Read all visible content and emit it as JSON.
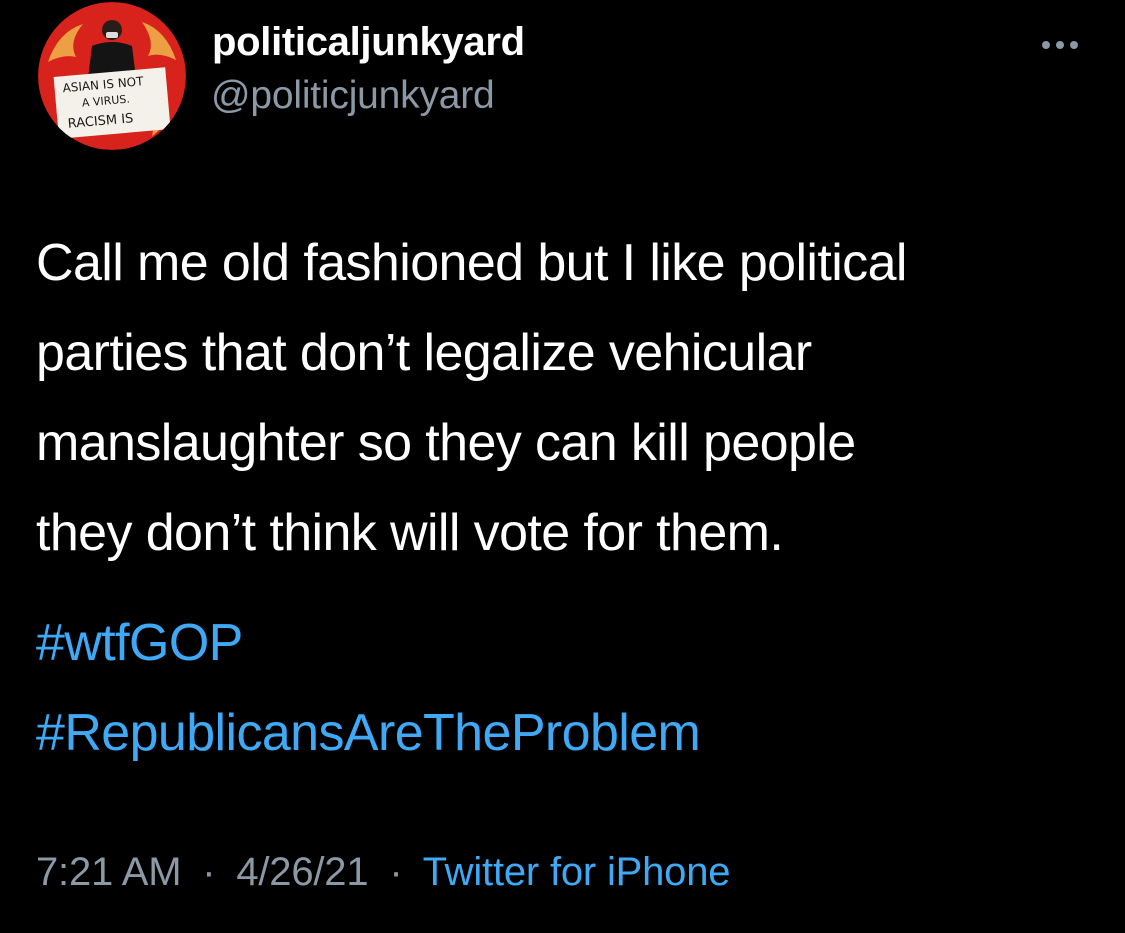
{
  "user": {
    "display_name": "politicaljunkyard",
    "handle": "@politicjunkyard",
    "avatar_sign": {
      "line1": "ASIAN IS NOT",
      "line2": "A VIRUS.",
      "line3": "RACISM IS"
    }
  },
  "more_icon": "more-horizontal-icon",
  "tweet": {
    "text_lines": [
      "Call me old fashioned but I like political",
      "parties that don’t legalize vehicular",
      "manslaughter so they can kill people",
      "they don’t think will vote for them."
    ],
    "hashtags": [
      "#wtfGOP",
      "#RepublicansAreTheProblem"
    ]
  },
  "meta": {
    "time": "7:21 AM",
    "separator": "·",
    "date": "4/26/21",
    "source": "Twitter for iPhone"
  },
  "colors": {
    "background": "#000000",
    "text": "#ffffff",
    "secondary": "#8b98a5",
    "link": "#3fa9f5",
    "avatar_ring": "#d8221c"
  }
}
